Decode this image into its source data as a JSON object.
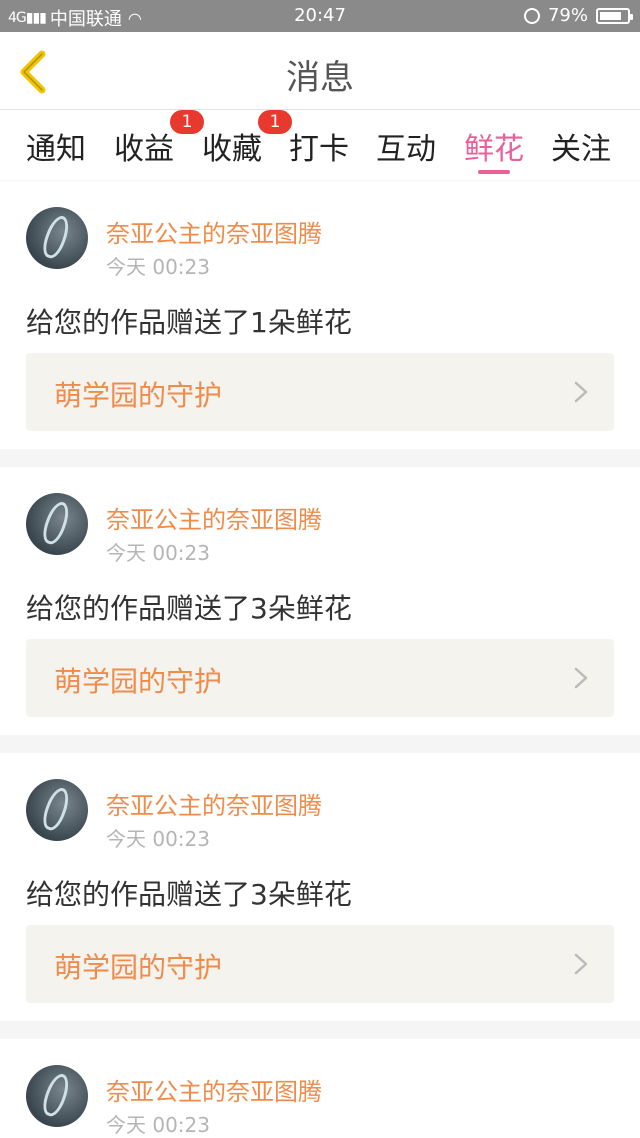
{
  "status_bar": {
    "carrier": "中国联通",
    "network": "4G",
    "time": "20:47",
    "battery": "79%",
    "battery_level": 0.79
  },
  "nav": {
    "title": "消息",
    "back_icon": "chevron-left-icon",
    "back_color": "#f2c400"
  },
  "tabs": [
    {
      "label": "通知"
    },
    {
      "label": "收益",
      "badge": "1"
    },
    {
      "label": "收藏",
      "badge": "1"
    },
    {
      "label": "打卡"
    },
    {
      "label": "互动"
    },
    {
      "label": "鲜花",
      "active": true
    },
    {
      "label": "关注"
    }
  ],
  "colors": {
    "accent": "#e9609a",
    "sender": "#f08b4a",
    "badge": "#e8392f"
  },
  "messages": [
    {
      "sender": "奈亚公主的奈亚图腾",
      "time": "今天 00:23",
      "text": "给您的作品赠送了1朵鲜花",
      "work": "萌学园的守护"
    },
    {
      "sender": "奈亚公主的奈亚图腾",
      "time": "今天 00:23",
      "text": "给您的作品赠送了3朵鲜花",
      "work": "萌学园的守护"
    },
    {
      "sender": "奈亚公主的奈亚图腾",
      "time": "今天 00:23",
      "text": "给您的作品赠送了3朵鲜花",
      "work": "萌学园的守护"
    },
    {
      "sender": "奈亚公主的奈亚图腾",
      "time": "今天 00:23"
    }
  ]
}
